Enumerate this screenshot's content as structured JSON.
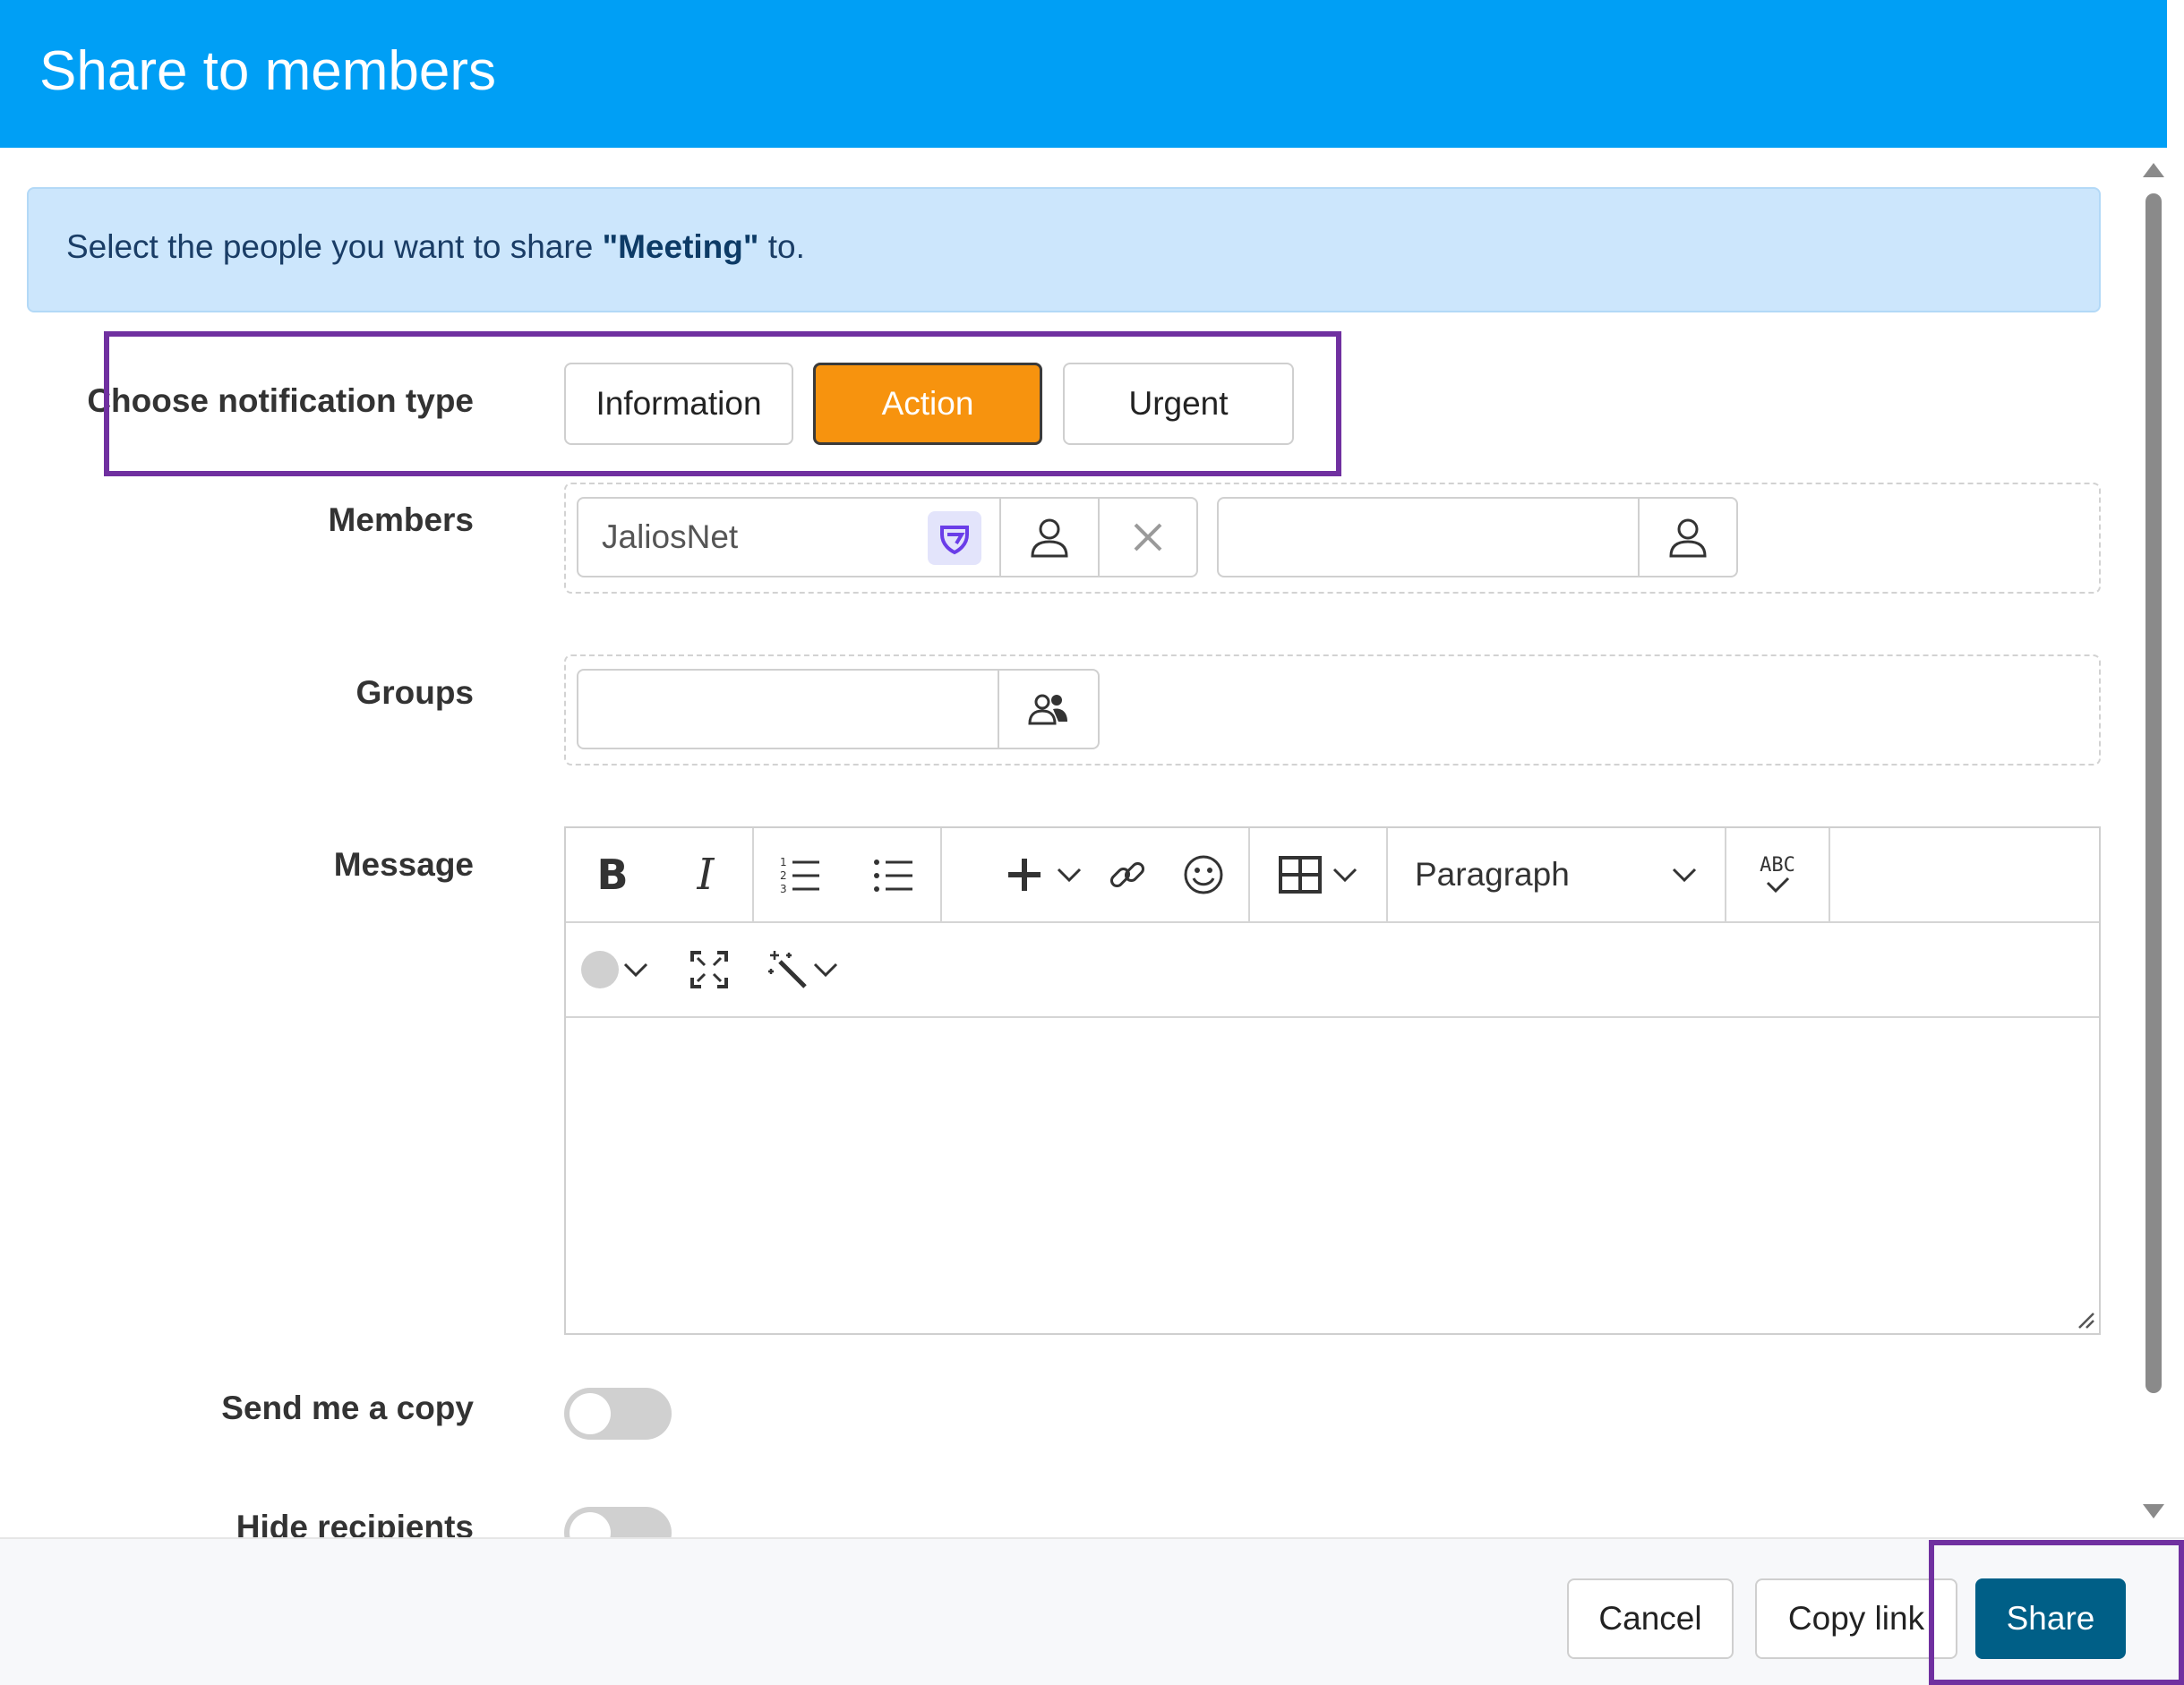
{
  "dialog": {
    "title": "Share to members",
    "banner": {
      "prefix": "Select the people you want to share ",
      "item_name": "\"Meeting\"",
      "suffix": " to."
    }
  },
  "form": {
    "notification_label": "Choose notification type",
    "notification_types": [
      "Information",
      "Action",
      "Urgent"
    ],
    "selected_notification": "Action",
    "members_label": "Members",
    "members": [
      {
        "name": "JaliosNet",
        "icon": "jalios-logo-icon"
      }
    ],
    "groups_label": "Groups",
    "message_label": "Message",
    "editor": {
      "paragraph_label": "Paragraph",
      "spellcheck_label": "ABC"
    },
    "send_copy_label": "Send me a copy",
    "send_copy_on": false,
    "hide_recipients_label": "Hide recipients",
    "hide_recipients_on": false
  },
  "footer": {
    "cancel": "Cancel",
    "copy_link": "Copy link",
    "share": "Share"
  },
  "colors": {
    "header": "#009ff5",
    "action": "#f7930e",
    "share": "#005f87",
    "highlight": "#7030a0"
  }
}
